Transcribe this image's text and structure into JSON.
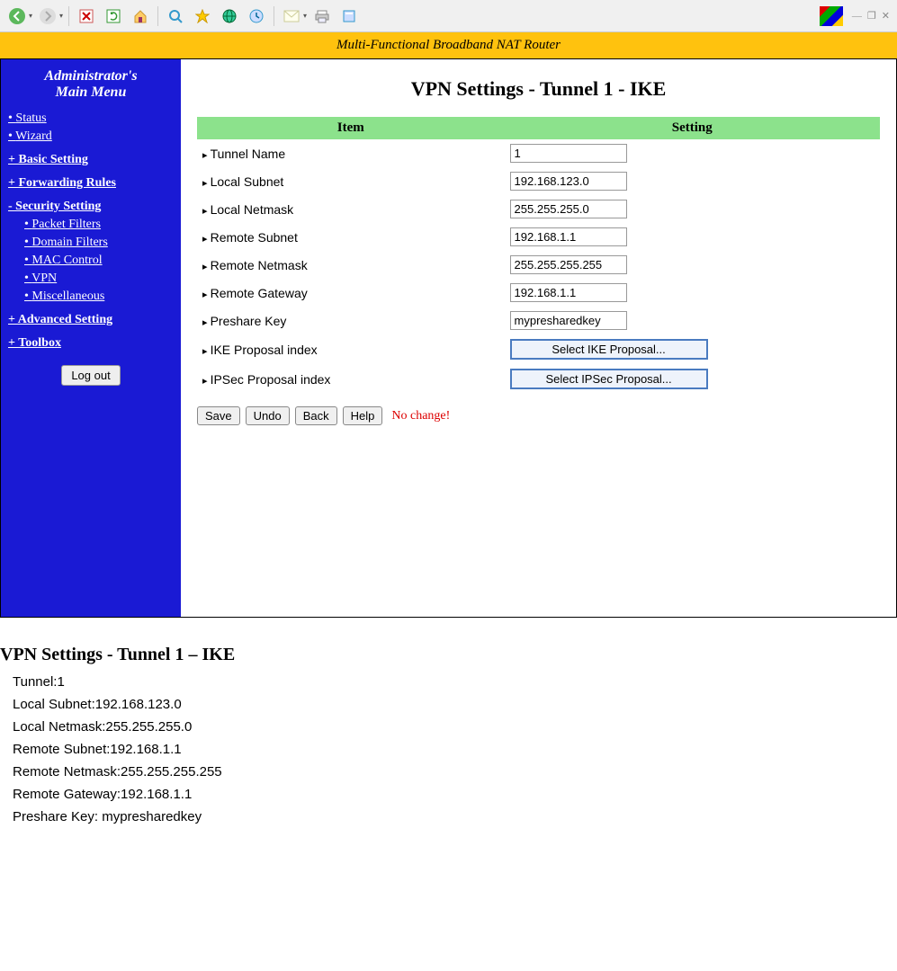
{
  "banner": {
    "title": "Multi-Functional Broadband NAT Router"
  },
  "sidebar": {
    "title_line1": "Administrator's",
    "title_line2": "Main Menu",
    "items": [
      {
        "label": "Status",
        "kind": "bullet"
      },
      {
        "label": "Wizard",
        "kind": "bullet"
      },
      {
        "label": "+ Basic Setting",
        "kind": "section"
      },
      {
        "label": "+ Forwarding Rules",
        "kind": "section"
      },
      {
        "label": "- Security Setting",
        "kind": "section"
      },
      {
        "label": "Packet Filters",
        "kind": "sub"
      },
      {
        "label": "Domain Filters",
        "kind": "sub"
      },
      {
        "label": "MAC Control",
        "kind": "sub"
      },
      {
        "label": "VPN",
        "kind": "sub"
      },
      {
        "label": "Miscellaneous",
        "kind": "sub"
      },
      {
        "label": "+ Advanced Setting",
        "kind": "section"
      },
      {
        "label": "+ Toolbox",
        "kind": "section"
      }
    ],
    "logout": "Log out"
  },
  "page": {
    "title": "VPN Settings - Tunnel 1 - IKE",
    "headers": {
      "item": "Item",
      "setting": "Setting"
    },
    "rows": [
      {
        "label": "Tunnel Name",
        "value": "1",
        "type": "text"
      },
      {
        "label": "Local Subnet",
        "value": "192.168.123.0",
        "type": "text"
      },
      {
        "label": "Local Netmask",
        "value": "255.255.255.0",
        "type": "text"
      },
      {
        "label": "Remote Subnet",
        "value": "192.168.1.1",
        "type": "text"
      },
      {
        "label": "Remote Netmask",
        "value": "255.255.255.255",
        "type": "text"
      },
      {
        "label": "Remote Gateway",
        "value": "192.168.1.1",
        "type": "text"
      },
      {
        "label": "Preshare Key",
        "value": "mypresharedkey",
        "type": "text"
      },
      {
        "label": "IKE Proposal index",
        "value": "Select IKE Proposal...",
        "type": "button"
      },
      {
        "label": "IPSec Proposal index",
        "value": "Select IPSec Proposal...",
        "type": "button"
      }
    ],
    "actions": {
      "save": "Save",
      "undo": "Undo",
      "back": "Back",
      "help": "Help",
      "status": "No change!"
    }
  },
  "doc": {
    "title": "VPN Settings - Tunnel 1 – IKE",
    "lines": [
      "Tunnel:1",
      "Local Subnet:192.168.123.0",
      "Local Netmask:255.255.255.0",
      "Remote Subnet:192.168.1.1",
      "Remote Netmask:255.255.255.255",
      "Remote Gateway:192.168.1.1",
      "Preshare Key: mypresharedkey"
    ]
  }
}
